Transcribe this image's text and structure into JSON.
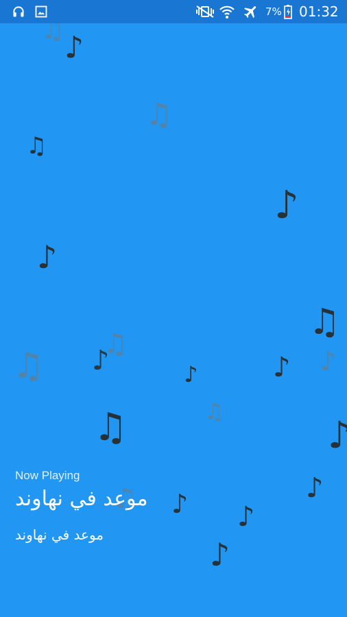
{
  "status_bar": {
    "battery_percent": "7%",
    "time": "01:32",
    "icons": [
      "headphones-icon",
      "image-icon",
      "vibrate-off-icon",
      "wifi-icon",
      "airplane-icon",
      "battery-charging-icon"
    ]
  },
  "now_playing": {
    "label": "Now Playing",
    "title": "موعد في نهاوند",
    "subtitle": "موعد في نهاوند"
  },
  "colors": {
    "background": "#2196f3",
    "status_bar": "#1976d2",
    "note_dark": "#263238",
    "note_faded": "#5f7f96"
  },
  "decoration": {
    "note_glyphs": [
      "♪",
      "♫"
    ]
  }
}
